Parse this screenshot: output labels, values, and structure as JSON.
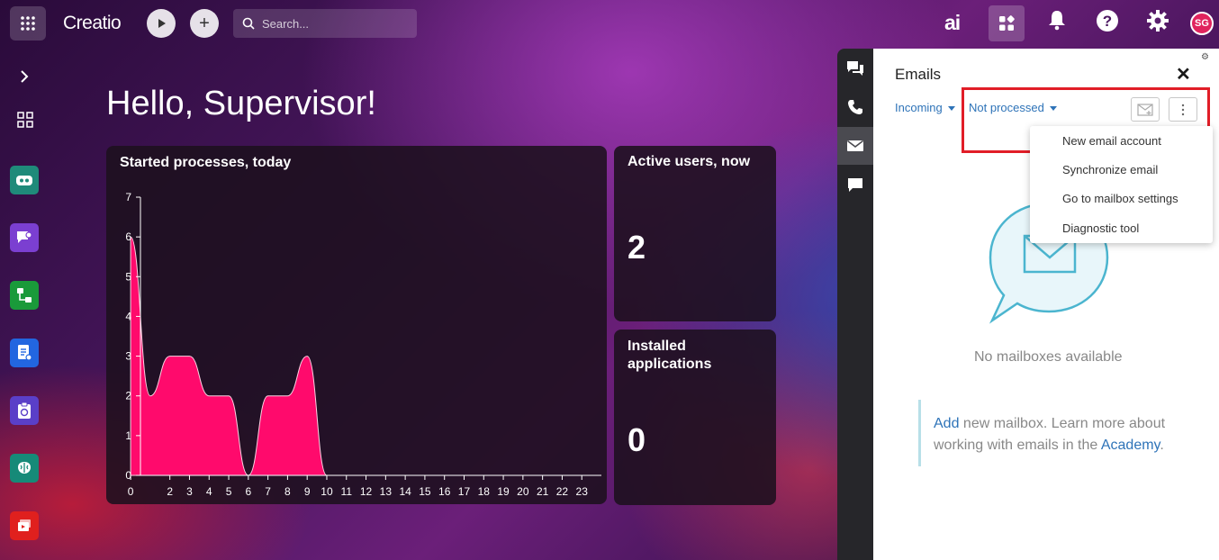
{
  "topbar": {
    "logo": "Creatio",
    "search_placeholder": "Search...",
    "ai_label": "ai",
    "avatar_initials": "SG"
  },
  "main": {
    "greeting": "Hello, Supervisor!",
    "widgets": {
      "active_users": {
        "title": "Active users, now",
        "value": "2"
      },
      "installed_apps": {
        "title": "Installed applications",
        "value": "0"
      }
    }
  },
  "chart_data": {
    "type": "area",
    "title": "Started processes, today",
    "x": [
      0,
      1,
      2,
      3,
      4,
      5,
      6,
      7,
      8,
      9,
      10,
      11,
      12,
      13,
      14,
      15,
      16,
      17,
      18,
      19,
      20,
      21,
      22,
      23
    ],
    "values": [
      6,
      2,
      3,
      3,
      2,
      2,
      0,
      2,
      2,
      3,
      0,
      0,
      0,
      0,
      0,
      0,
      0,
      0,
      0,
      0,
      0,
      0,
      0,
      0
    ],
    "xticks": [
      "0",
      "2",
      "3",
      "4",
      "5",
      "6",
      "7",
      "8",
      "9",
      "10",
      "11",
      "12",
      "13",
      "14",
      "15",
      "16",
      "17",
      "18",
      "19",
      "20",
      "21",
      "22",
      "23"
    ],
    "yticks": [
      "0",
      "1",
      "2",
      "3",
      "4",
      "5",
      "6",
      "7"
    ],
    "ylim": [
      0,
      7
    ],
    "color": "#ff0a6c"
  },
  "email_panel": {
    "title": "Emails",
    "filter_direction": "Incoming",
    "filter_status": "Not processed",
    "menu_items": [
      "New email account",
      "Synchronize email",
      "Go to mailbox settings",
      "Diagnostic tool"
    ],
    "empty_text": "No mailboxes available",
    "info": {
      "add_link": "Add",
      "text1": " new mailbox. Learn more about working with emails in the ",
      "academy_link": "Academy",
      "text2": "."
    }
  },
  "colors": {
    "highlight": "#e11d27",
    "link": "#2e73b8",
    "chart_fill": "#ff0a6c"
  }
}
